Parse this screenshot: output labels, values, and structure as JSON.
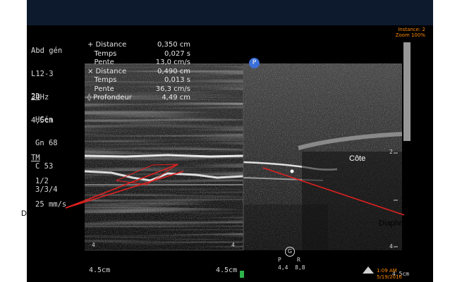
{
  "left_panel": {
    "lines_top": [
      "Abd gén",
      "L12-3",
      "34Hz",
      "4,5cm"
    ],
    "mode_2d": "2D",
    "lines_2d": [
      "HGén",
      "Gn 68",
      "C 53",
      "3/3/4"
    ],
    "mode_tm": "TM",
    "lines_tm": [
      "1/2",
      "25 mm/s"
    ]
  },
  "measurements": [
    {
      "label": "+ Distance",
      "value": "0,350 cm"
    },
    {
      "label": "   Temps",
      "value": "0,027 s"
    },
    {
      "label": "   Pente",
      "value": "13,0 cm/s"
    },
    {
      "label": "× Distance",
      "value": "0,490 cm"
    },
    {
      "label": "   Temps",
      "value": "0,013 s"
    },
    {
      "label": "   Pente",
      "value": "36,3 cm/s"
    },
    {
      "label": "◊ Profondeur",
      "value": "4,49 cm"
    }
  ],
  "top_right": {
    "line1": "Instance: 2",
    "line2": "Zoom 100%"
  },
  "p_marker": "P",
  "depth_labels": {
    "left_bottom": "4.5cm",
    "right_bottom": "4.5cm",
    "bottom_right": "4.5cm",
    "tick_2": "2",
    "tick_4": "4"
  },
  "probe": {
    "letter": "G",
    "p": "P",
    "r": "R",
    "values": "4,4  8,8"
  },
  "footer_time": "1:09 AM",
  "footer_date": "5/19/2016",
  "annotations": {
    "left": "Diaphragme",
    "right": "Diaphragme",
    "cote": "Côte"
  },
  "colors": {
    "annotation_line": "#e02020",
    "background": "#000000"
  }
}
